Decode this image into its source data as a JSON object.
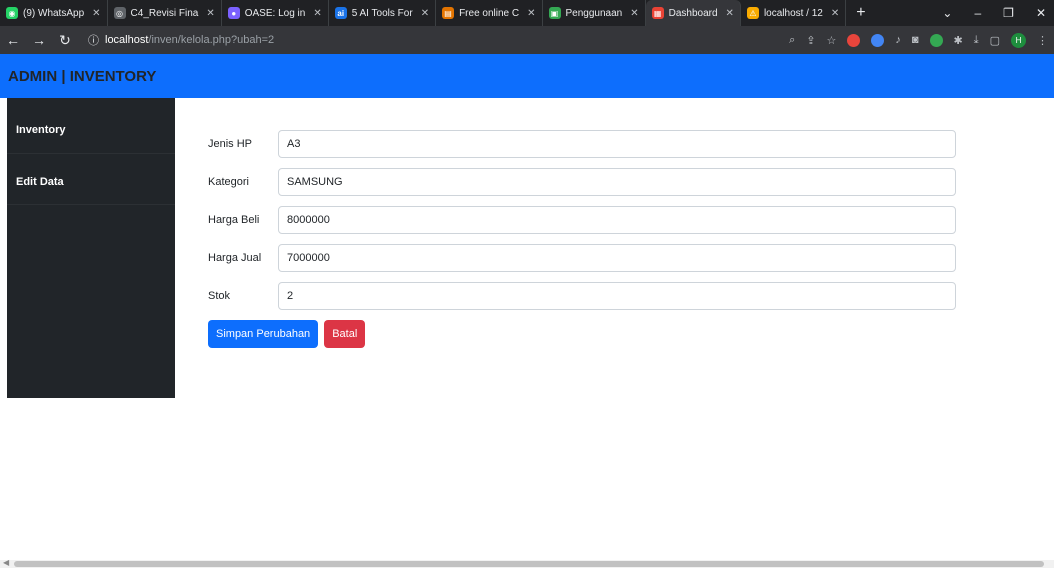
{
  "browser": {
    "tabs": [
      {
        "label": "(9) WhatsApp",
        "icon": "whatsapp-icon",
        "color": "#25d366",
        "glyph": "◉"
      },
      {
        "label": "C4_Revisi Fina",
        "icon": "chrome-icon",
        "color": "#5f6368",
        "glyph": "◎"
      },
      {
        "label": "OASE: Log in",
        "icon": "oase-icon",
        "color": "#7b61ff",
        "glyph": "●"
      },
      {
        "label": "5 AI Tools For",
        "icon": "ai-icon",
        "color": "#1a73e8",
        "glyph": "ai"
      },
      {
        "label": "Free online C",
        "icon": "ocr-icon",
        "color": "#e37400",
        "glyph": "▤"
      },
      {
        "label": "Penggunaan",
        "icon": "doc-icon",
        "color": "#34a853",
        "glyph": "▣"
      },
      {
        "label": "Dashboard",
        "icon": "dashboard-icon",
        "color": "#ea4335",
        "glyph": "▦",
        "active": true
      },
      {
        "label": "localhost / 12",
        "icon": "phpmyadmin-icon",
        "color": "#f9ab00",
        "glyph": "⚠"
      }
    ],
    "new_tab": "+",
    "url_host": "localhost",
    "url_path": "/inven/kelola.php?ubah=2",
    "avatar_initial": "H"
  },
  "navbar": {
    "brand": "ADMIN | INVENTORY"
  },
  "sidebar": {
    "items": [
      {
        "label": "Inventory"
      },
      {
        "label": "Edit Data"
      }
    ]
  },
  "form": {
    "fields": [
      {
        "label": "Jenis HP",
        "value": "A3"
      },
      {
        "label": "Kategori",
        "value": "SAMSUNG"
      },
      {
        "label": "Harga Beli",
        "value": "8000000"
      },
      {
        "label": "Harga Jual",
        "value": "7000000"
      },
      {
        "label": "Stok",
        "value": "2"
      }
    ],
    "save_label": "Simpan Perubahan",
    "cancel_label": "Batal"
  },
  "colors": {
    "primary": "#0d6efd",
    "danger": "#dc3545",
    "sidebar": "#212529"
  }
}
